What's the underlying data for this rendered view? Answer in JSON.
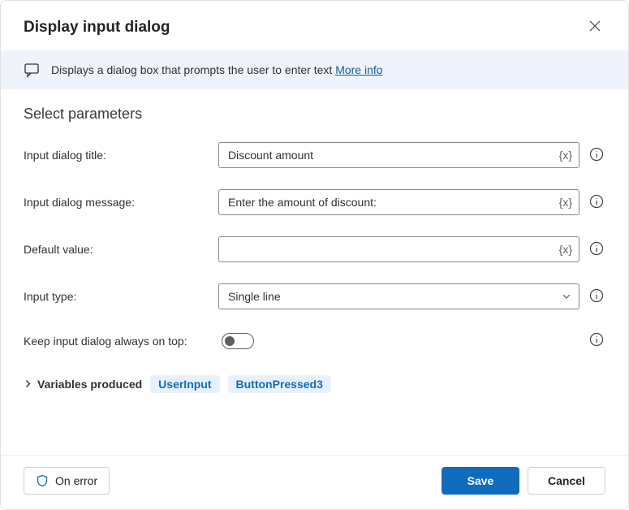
{
  "header": {
    "title": "Display input dialog"
  },
  "banner": {
    "text": "Displays a dialog box that prompts the user to enter text ",
    "link": "More info"
  },
  "section_title": "Select parameters",
  "params": {
    "title": {
      "label": "Input dialog title:",
      "value": "Discount amount"
    },
    "message": {
      "label": "Input dialog message:",
      "value": "Enter the amount of discount:"
    },
    "default_value": {
      "label": "Default value:",
      "value": ""
    },
    "input_type": {
      "label": "Input type:",
      "value": "Single line"
    },
    "always_on_top": {
      "label": "Keep input dialog always on top:",
      "value": false
    }
  },
  "variables_produced": {
    "label": "Variables produced",
    "vars": [
      "UserInput",
      "ButtonPressed3"
    ]
  },
  "footer": {
    "on_error": "On error",
    "save": "Save",
    "cancel": "Cancel"
  },
  "tokens": {
    "var_insert": "{x}"
  }
}
